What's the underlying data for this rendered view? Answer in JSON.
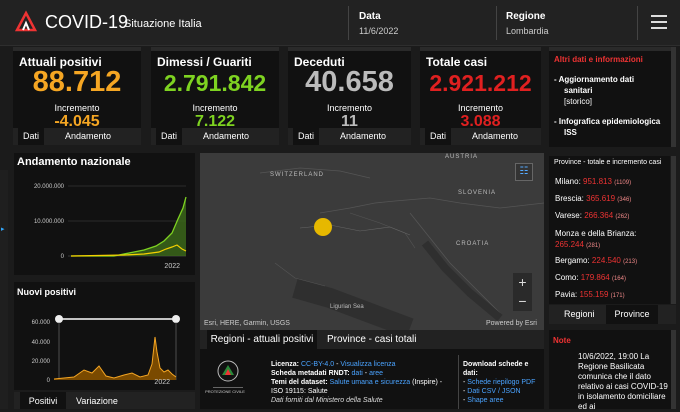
{
  "header": {
    "title": "COVID-19",
    "subtitle": "Situazione Italia",
    "date_label": "Data",
    "date_value": "11/6/2022",
    "region_label": "Regione",
    "region_value": "Lombardia"
  },
  "cards": [
    {
      "title": "Attuali positivi",
      "value": "88.712",
      "inc_label": "Incremento",
      "inc_value": "-4.045",
      "color": "#f5a623",
      "tab1": "Dati",
      "tab2": "Andamento"
    },
    {
      "title": "Dimessi / Guariti",
      "value": "2.791.842",
      "inc_label": "Incremento",
      "inc_value": "7.122",
      "color": "#7ed321",
      "tab1": "Dati",
      "tab2": "Andamento"
    },
    {
      "title": "Deceduti",
      "value": "40.658",
      "inc_label": "Incremento",
      "inc_value": "11",
      "color": "#bbbbbb",
      "tab1": "Dati",
      "tab2": "Andamento"
    },
    {
      "title": "Totale casi",
      "value": "2.921.212",
      "inc_label": "Incremento",
      "inc_value": "3.088",
      "color": "#e02020",
      "tab1": "Dati",
      "tab2": "Andamento"
    }
  ],
  "side": {
    "title": "Altri dati e informazioni",
    "item1a": "- Aggiornamento dati",
    "item1b": "sanitari",
    "item1c": "[storico]",
    "item2a": "- Infografica epidemiologica",
    "item2b": "ISS"
  },
  "andamento": {
    "title": "Andamento nazionale",
    "y_ticks": [
      "20.000.000",
      "10.000.000",
      "0"
    ],
    "x_tick": "2022"
  },
  "nuovi": {
    "title": "Nuovi positivi",
    "y_ticks": [
      "60.000",
      "40.000",
      "20.000",
      "0"
    ],
    "x_tick": "2022",
    "tab1": "Positivi",
    "tab2": "Variazione"
  },
  "map": {
    "labels": [
      "AUSTRIA",
      "SWITZERLAND",
      "SLOVENIA",
      "CROATIA",
      "Ligurian Sea"
    ],
    "attribution": "Esri, HERE, Garmin, USGS",
    "powered": "Powered by Esri",
    "tab1": "Regioni - attuali positivi",
    "tab2": "Province - casi totali"
  },
  "province": {
    "title": "Province - totale e incremento casi",
    "rows": [
      {
        "name": "Milano:",
        "value": "951.813",
        "delta": "(1109)"
      },
      {
        "name": "Brescia:",
        "value": "365.619",
        "delta": "(346)"
      },
      {
        "name": "Varese:",
        "value": "266.364",
        "delta": "(262)"
      },
      {
        "name": "Monza e della Brianza:",
        "value": "265.244",
        "delta": "(281)"
      },
      {
        "name": "Bergamo:",
        "value": "224.540",
        "delta": "(213)"
      },
      {
        "name": "Como:",
        "value": "179.864",
        "delta": "(164)"
      },
      {
        "name": "Pavia:",
        "value": "155.159",
        "delta": "(171)"
      }
    ],
    "tab1": "Regioni",
    "tab2": "Province"
  },
  "info": {
    "licenza_label": "Licenza:",
    "licenza_value": "CC-BY-4.0",
    "licenza_link": "Visualizza licenza",
    "scheda_label": "Scheda metadati RNDT:",
    "scheda_value": "dati",
    "scheda_link": "aree",
    "temi_label": "Temi del dataset:",
    "temi_value": "Salute umana e sicurezza",
    "temi_extra": "(Inspire) - ISO 19115: Salute",
    "fonte": "Dati forniti dal Ministero della Salute",
    "dl_title": "Download schede e dati:",
    "dl1": "Schede riepilogo PDF",
    "dl2": "Dati CSV / JSON",
    "dl3": "Shape aree",
    "pc_label": "PROTEZIONE CIVILE"
  },
  "note": {
    "title": "Note",
    "text": "10/6/2022, 19:00 La Regione Basilicata comunica che il dato relativo ai casi COVID-19 in isolamento domiciliare ed ai"
  }
}
